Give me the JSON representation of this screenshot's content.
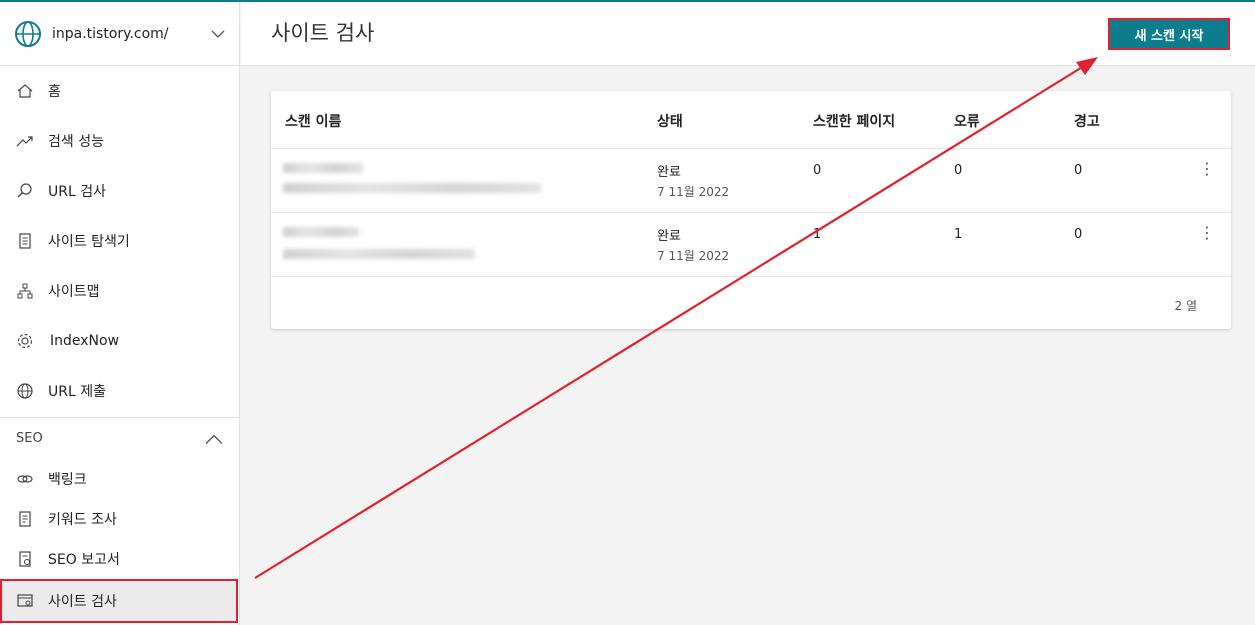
{
  "site": {
    "url": "inpa.tistory.com/"
  },
  "nav": {
    "items": [
      {
        "label": "홈",
        "icon": "home-icon"
      },
      {
        "label": "검색 성능",
        "icon": "trend-icon"
      },
      {
        "label": "URL 검사",
        "icon": "search-icon"
      },
      {
        "label": "사이트 탐색기",
        "icon": "document-icon"
      },
      {
        "label": "사이트맵",
        "icon": "sitemap-icon"
      },
      {
        "label": "IndexNow",
        "icon": "gear-icon"
      },
      {
        "label": "URL 제출",
        "icon": "globe-icon"
      }
    ],
    "seo_section": "SEO",
    "seo_items": [
      {
        "label": "백링크",
        "icon": "link-icon"
      },
      {
        "label": "키워드 조사",
        "icon": "list-icon"
      },
      {
        "label": "SEO 보고서",
        "icon": "report-icon"
      },
      {
        "label": "사이트 검사",
        "icon": "site-scan-icon"
      }
    ]
  },
  "header": {
    "title": "사이트 검사",
    "new_scan_label": "새 스캔 시작"
  },
  "table": {
    "columns": [
      "스캔 이름",
      "상태",
      "스캔한 페이지",
      "오류",
      "경고"
    ],
    "rows": [
      {
        "status": "완료",
        "date": "7 11월 2022",
        "pages": "0",
        "errors": "0",
        "warnings": "0"
      },
      {
        "status": "완료",
        "date": "7 11월 2022",
        "pages": "1",
        "errors": "1",
        "warnings": "0"
      }
    ],
    "row_count": "2 열"
  },
  "colors": {
    "accent": "#0d7d8e",
    "highlight": "#e0202a"
  }
}
